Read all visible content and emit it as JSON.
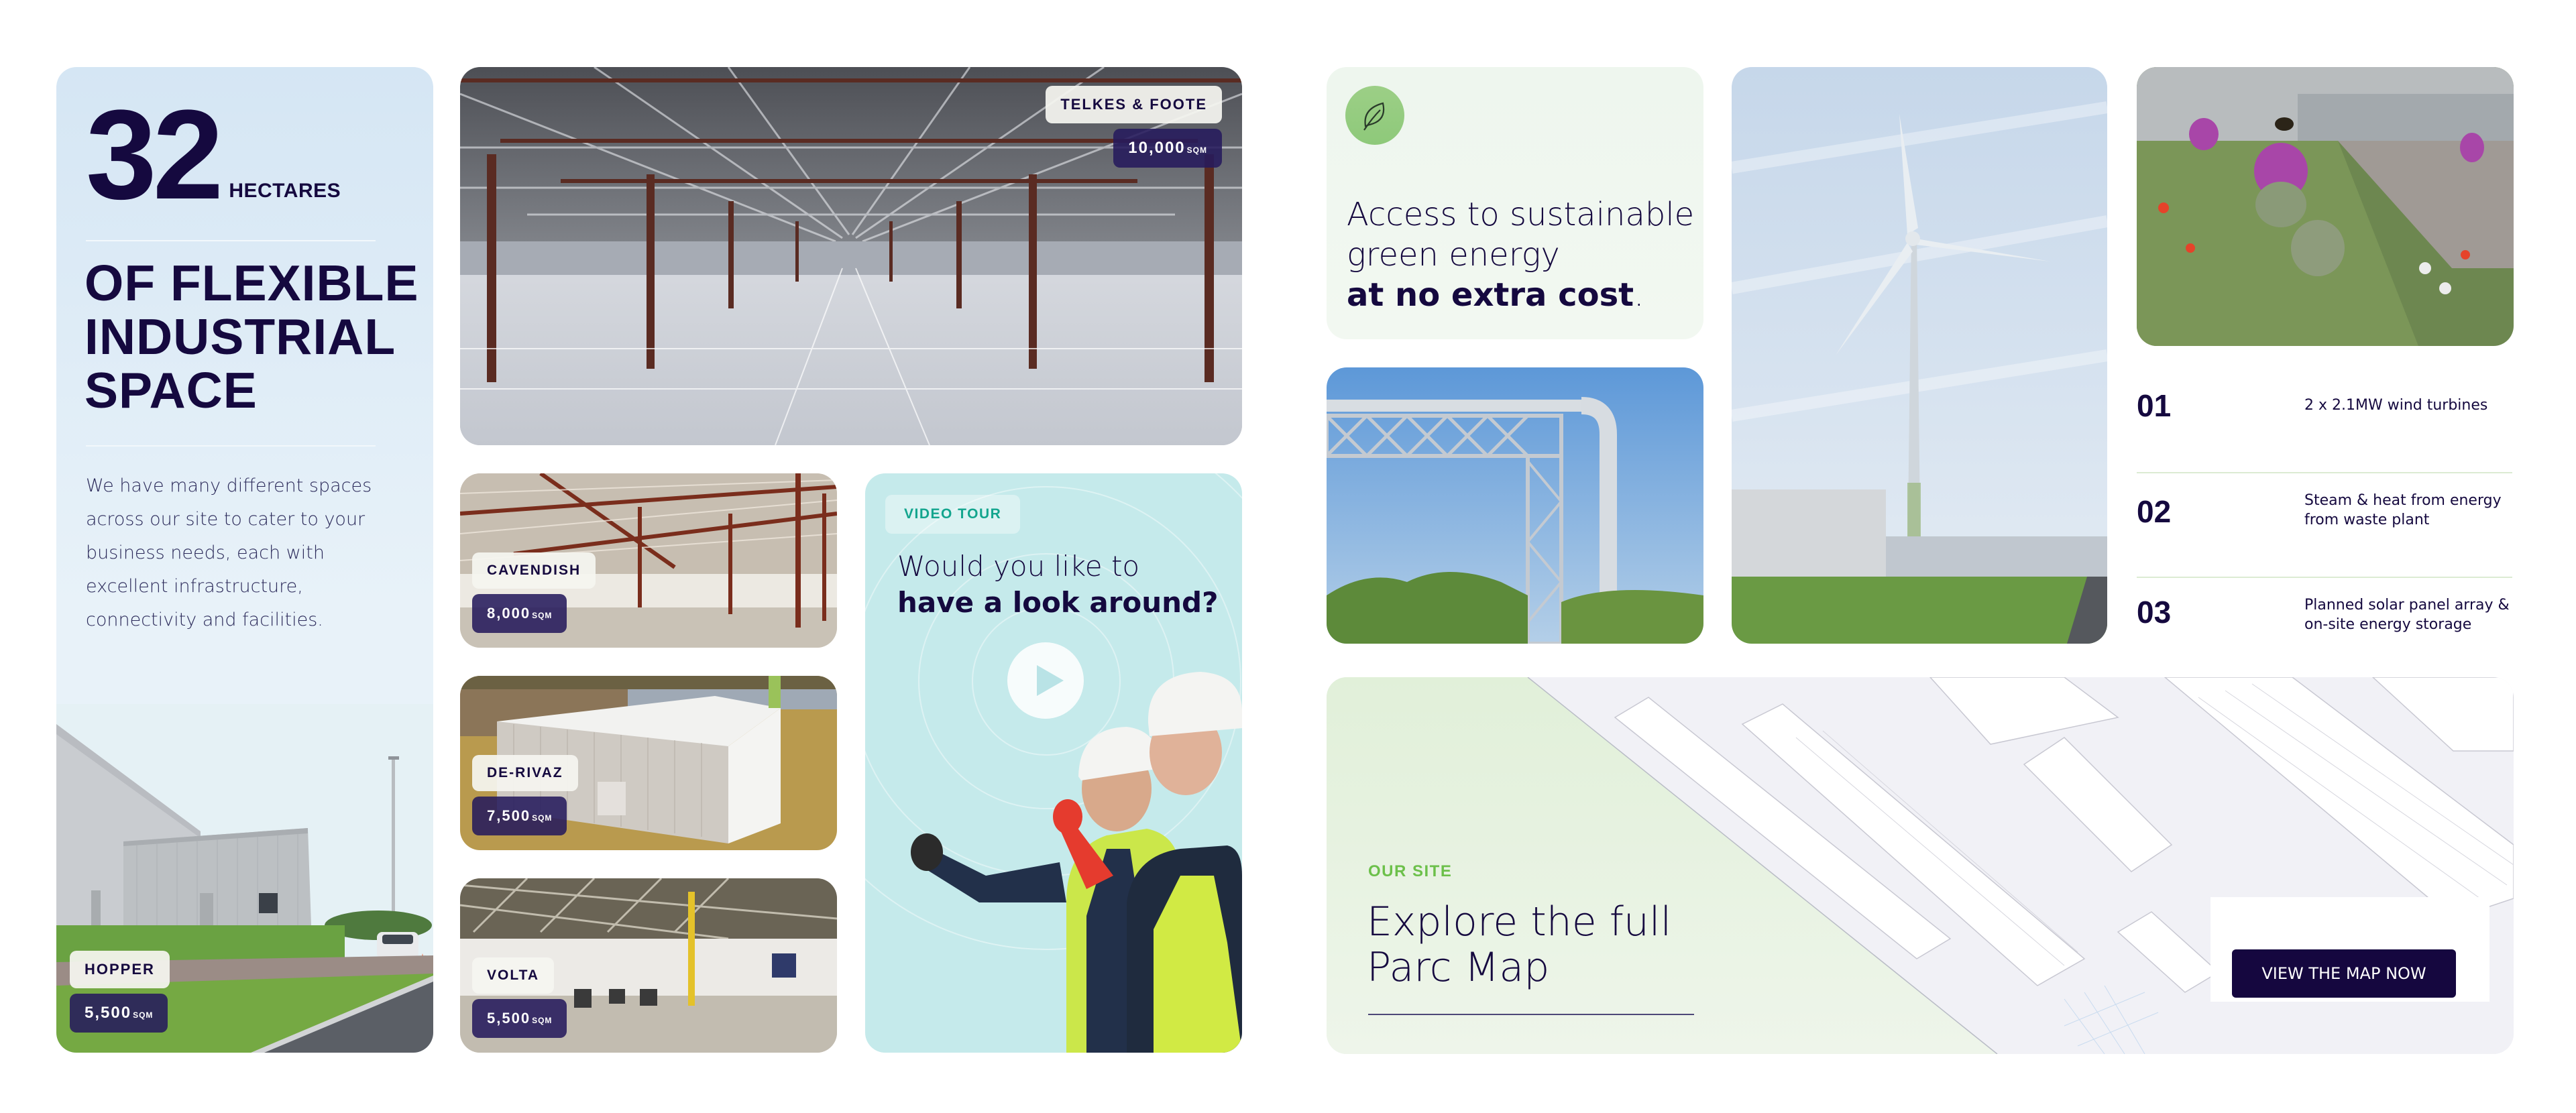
{
  "hero": {
    "number": "32",
    "unit": "HECTARES",
    "headline_lines": [
      "OF FLEXIBLE",
      "INDUSTRIAL",
      "SPACE"
    ],
    "description": "We have many different spaces across our site to cater to your business needs, each with excellent infrastructure, connectivity and facilities.",
    "unit_tag": {
      "name": "HOPPER",
      "size": "5,500",
      "size_unit": "SQM"
    }
  },
  "units": [
    {
      "name": "TELKES & FOOTE",
      "size": "10,000",
      "size_unit": "SQM"
    },
    {
      "name": "CAVENDISH",
      "size": "8,000",
      "size_unit": "SQM"
    },
    {
      "name": "DE-RIVAZ",
      "size": "7,500",
      "size_unit": "SQM"
    },
    {
      "name": "VOLTA",
      "size": "5,500",
      "size_unit": "SQM"
    }
  ],
  "video": {
    "label": "VIDEO TOUR",
    "question_line1": "Would you like to",
    "question_line2": "have a look around?",
    "play_icon": "play-icon"
  },
  "green_energy": {
    "icon": "leaf-icon",
    "line1": "Access to sustainable",
    "line2": "green energy",
    "line3_bold": "at no extra cost",
    "line3_end": "."
  },
  "features": [
    {
      "number": "01",
      "text": "2 x 2.1MW wind turbines"
    },
    {
      "number": "02",
      "text": "Steam & heat from energy from waste plant"
    },
    {
      "number": "03",
      "text": "Planned solar panel array & on-site energy storage"
    }
  ],
  "map": {
    "eyebrow": "OUR SITE",
    "title_line1": "Explore the full",
    "title_line2": "Parc Map",
    "cta_label": "VIEW THE MAP NOW"
  },
  "colors": {
    "navy": "#15093f",
    "hero_bg": "#d5e6f4",
    "video_bg": "#c5eaeb",
    "teal_accent": "#13a58e",
    "green_accent": "#6cc04a",
    "leaf_circle": "#9ccf86",
    "tag_size_bg": "#261a5c"
  }
}
